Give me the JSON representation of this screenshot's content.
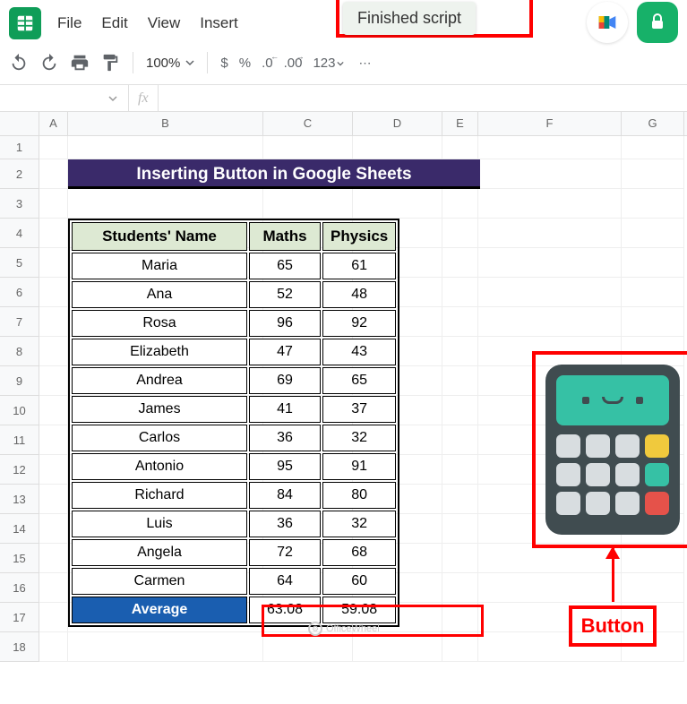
{
  "menu": {
    "file": "File",
    "edit": "Edit",
    "view": "View",
    "insert": "Insert"
  },
  "tooltip": "Finished script",
  "zoom": "100%",
  "toolbar": {
    "dollar": "$",
    "percent": "%",
    "dec1": ".0",
    "dec2": ".00",
    "num": "123"
  },
  "fx": "fx",
  "columns": {
    "a": "A",
    "b": "B",
    "c": "C",
    "d": "D",
    "e": "E",
    "f": "F",
    "g": "G"
  },
  "rows": [
    "1",
    "2",
    "3",
    "4",
    "5",
    "6",
    "7",
    "8",
    "9",
    "10",
    "11",
    "12",
    "13",
    "14",
    "15",
    "16",
    "17",
    "18"
  ],
  "title": "Inserting Button in Google Sheets",
  "headers": {
    "name": "Students' Name",
    "maths": "Maths",
    "physics": "Physics"
  },
  "students": [
    {
      "name": "Maria",
      "m": "65",
      "p": "61"
    },
    {
      "name": "Ana",
      "m": "52",
      "p": "48"
    },
    {
      "name": "Rosa",
      "m": "96",
      "p": "92"
    },
    {
      "name": "Elizabeth",
      "m": "47",
      "p": "43"
    },
    {
      "name": "Andrea",
      "m": "69",
      "p": "65"
    },
    {
      "name": "James",
      "m": "41",
      "p": "37"
    },
    {
      "name": "Carlos",
      "m": "36",
      "p": "32"
    },
    {
      "name": "Antonio",
      "m": "95",
      "p": "91"
    },
    {
      "name": "Richard",
      "m": "84",
      "p": "80"
    },
    {
      "name": "Luis",
      "m": "36",
      "p": "32"
    },
    {
      "name": "Angela",
      "m": "72",
      "p": "68"
    },
    {
      "name": "Carmen",
      "m": "64",
      "p": "60"
    }
  ],
  "average": {
    "label": "Average",
    "m": "63.08",
    "p": "59.08"
  },
  "button_label": "Button",
  "watermark": "OfficeWheel",
  "chart_data": {
    "type": "table",
    "title": "Inserting Button in Google Sheets",
    "columns": [
      "Students' Name",
      "Maths",
      "Physics"
    ],
    "rows": [
      [
        "Maria",
        65,
        61
      ],
      [
        "Ana",
        52,
        48
      ],
      [
        "Rosa",
        96,
        92
      ],
      [
        "Elizabeth",
        47,
        43
      ],
      [
        "Andrea",
        69,
        65
      ],
      [
        "James",
        41,
        37
      ],
      [
        "Carlos",
        36,
        32
      ],
      [
        "Antonio",
        95,
        91
      ],
      [
        "Richard",
        84,
        80
      ],
      [
        "Luis",
        36,
        32
      ],
      [
        "Angela",
        72,
        68
      ],
      [
        "Carmen",
        64,
        60
      ]
    ],
    "summary": {
      "label": "Average",
      "Maths": 63.08,
      "Physics": 59.08
    }
  }
}
